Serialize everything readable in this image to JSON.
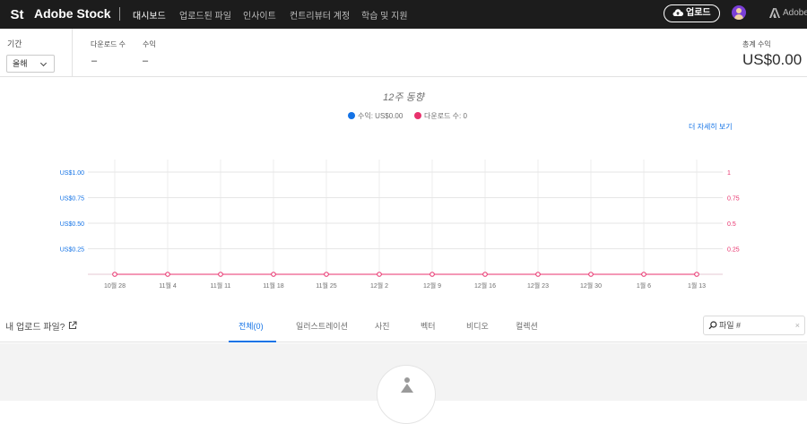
{
  "header": {
    "logo_badge": "St",
    "logo_text": "Adobe Stock",
    "nav": [
      "대시보드",
      "업로드된 파일",
      "인사이트",
      "컨트리뷰터 계정",
      "학습 및 지원"
    ],
    "upload_label": "업로드",
    "adobe_label": "Adobe",
    "icons": [
      "cloud-upload-icon",
      "avatar",
      "adobe-logo-icon"
    ]
  },
  "stats": {
    "period_label": "기간",
    "period_value": "올해",
    "downloads_label": "다운로드 수",
    "downloads_value": "–",
    "revenue_label": "수익",
    "revenue_value": "–",
    "total_revenue_label": "총계 수익",
    "total_revenue_value": "US$0.00"
  },
  "chart": {
    "title": "12주 동향",
    "legend_revenue": "수익: US$0.00",
    "legend_downloads": "다운로드 수: 0",
    "more_link": "더 자세히 보기"
  },
  "chart_data": {
    "type": "line",
    "title": "12주 동향",
    "categories": [
      "10월 28",
      "11월 4",
      "11월 11",
      "11월 18",
      "11월 25",
      "12월 2",
      "12월 9",
      "12월 16",
      "12월 23",
      "12월 30",
      "1월 6",
      "1월 13"
    ],
    "series": [
      {
        "name": "수익",
        "axis": "left",
        "values": [
          0,
          0,
          0,
          0,
          0,
          0,
          0,
          0,
          0,
          0,
          0,
          0
        ],
        "color": "#1473e6"
      },
      {
        "name": "다운로드 수",
        "axis": "right",
        "values": [
          0,
          0,
          0,
          0,
          0,
          0,
          0,
          0,
          0,
          0,
          0,
          0
        ],
        "color": "#e8326d"
      }
    ],
    "left_ticks": [
      "US$1.00",
      "US$0.75",
      "US$0.50",
      "US$0.25"
    ],
    "right_ticks": [
      "1",
      "0.75",
      "0.5",
      "0.25"
    ],
    "ylim_left": [
      0,
      1
    ],
    "ylim_right": [
      0,
      1
    ],
    "grid": true,
    "legend": "top-center"
  },
  "filters": {
    "title": "내 업로드 파일?",
    "tabs": [
      "전체(0)",
      "일러스트레이션",
      "사진",
      "벡터",
      "비디오",
      "컬렉션"
    ],
    "search_placeholder": "파일 #",
    "clear_glyph": "×"
  },
  "colors": {
    "topbar": "#1c1c1c",
    "accent_blue": "#1473e6",
    "accent_pink": "#e8326d",
    "content_bg": "#f3f3f3"
  }
}
